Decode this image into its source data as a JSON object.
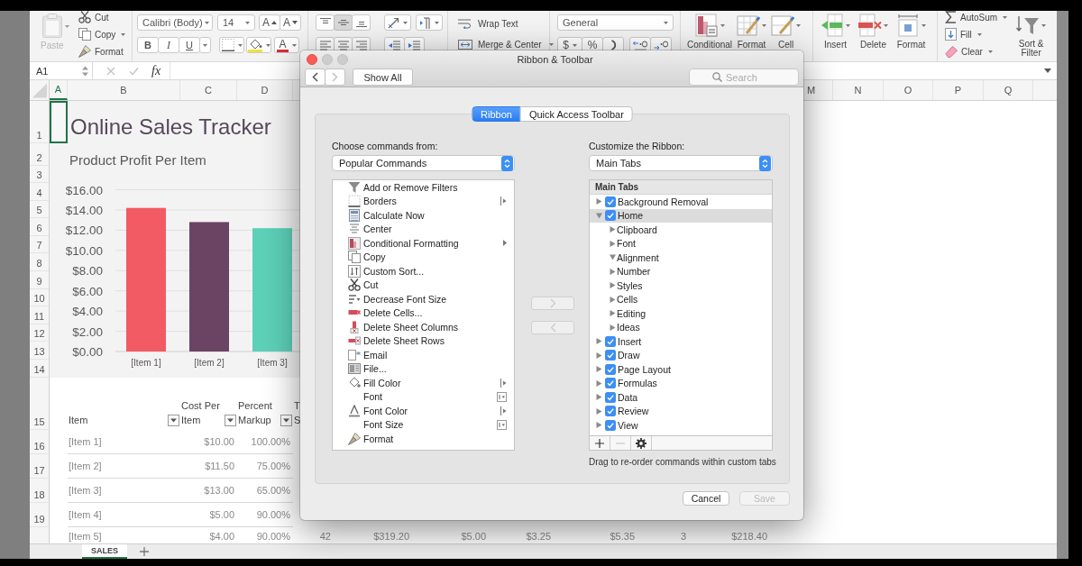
{
  "ribbon": {
    "paste": {
      "label": "Paste",
      "disabled": true
    },
    "clipboard": [
      "Cut",
      "Copy",
      "Format"
    ],
    "font": {
      "name": "Calibri (Body)",
      "size": "14",
      "grow": "A",
      "shrink": "A",
      "bold": "B",
      "italic": "I",
      "underline": "U",
      "paint_button": "A"
    },
    "vertical_align": [
      {
        "selected": false
      },
      {
        "selected": true
      },
      {
        "selected": false
      }
    ],
    "wrap_text": "Wrap Text",
    "merge": "Merge & Center",
    "number": {
      "format": "General",
      "currency": "$",
      "percent": "%"
    },
    "styles": [
      "Conditional",
      "Format",
      "Cell"
    ],
    "cells": [
      "Insert",
      "Delete",
      "Format"
    ],
    "editing": [
      "AutoSum",
      "Fill",
      "Clear"
    ],
    "sort_filter": "Sort &\nFilter"
  },
  "formula_bar": {
    "name_box": "A1",
    "function_label": "fx"
  },
  "sheet": {
    "columns": [
      {
        "label": "A",
        "selected": true
      },
      {
        "label": "B",
        "selected": false
      },
      {
        "label": "C",
        "selected": false
      },
      {
        "label": "D",
        "selected": false
      },
      {
        "label": "M",
        "selected": false
      },
      {
        "label": "N",
        "selected": false
      },
      {
        "label": "O",
        "selected": false
      },
      {
        "label": "P",
        "selected": false
      },
      {
        "label": "Q",
        "selected": false
      }
    ],
    "rows": [
      "1",
      "2",
      "3",
      "4",
      "5",
      "6",
      "7",
      "8",
      "9",
      "10",
      "11",
      "12",
      "13",
      "14",
      "15",
      "16",
      "17",
      "18",
      "19"
    ],
    "title": "Online Sales Tracker",
    "chart": {
      "chart_data": {
        "type": "bar",
        "title": "Product Profit Per Item",
        "categories": [
          "[Item 1]",
          "[Item 2]",
          "[Item 3]"
        ],
        "values": [
          14.2,
          12.8,
          12.2
        ],
        "colors": [
          "#f25a64",
          "#6a4462",
          "#5dd1b8"
        ],
        "ylim": [
          0,
          16
        ],
        "grid": true,
        "yticks": [
          {
            "value": 0,
            "label": "$0.00"
          },
          {
            "value": 2,
            "label": "$2.00"
          },
          {
            "value": 4,
            "label": "$4.00"
          },
          {
            "value": 6,
            "label": "$6.00"
          },
          {
            "value": 8,
            "label": "$8.00"
          },
          {
            "value": 10,
            "label": "$10.00"
          },
          {
            "value": 12,
            "label": "$12.00"
          },
          {
            "value": 14,
            "label": "$14.00"
          },
          {
            "value": 16,
            "label": "$16.00"
          }
        ]
      }
    },
    "table": {
      "columns": [
        {
          "label": "Item",
          "filter": true
        },
        {
          "label": "Cost Per\nItem",
          "filter": true
        },
        {
          "label": "Percent\nMarkup",
          "filter": true
        },
        {
          "label": "T\nS",
          "filter": false
        }
      ],
      "rows": [
        {
          "cells": [
            "[Item 1]",
            "$10.00",
            "100.00%"
          ]
        },
        {
          "cells": [
            "[Item 2]",
            "$11.50",
            "75.00%"
          ]
        },
        {
          "cells": [
            "[Item 3]",
            "$13.00",
            "65.00%"
          ]
        },
        {
          "cells": [
            "[Item 4]",
            "$5.00",
            "90.00%"
          ]
        },
        {
          "cells": [
            "[Item 5]",
            "$4.00",
            "90.00%",
            "42",
            "$319.20",
            "$5.00",
            "$3.25",
            "$5.35",
            "3",
            "$218.40"
          ]
        }
      ]
    },
    "sheet_tabs": [
      {
        "label": "SALES",
        "selected": true
      }
    ]
  },
  "dialog": {
    "title": "Ribbon & Toolbar",
    "window_buttons": [
      {
        "kind": "close",
        "disabled": false
      },
      {
        "kind": "minimize",
        "disabled": true
      },
      {
        "kind": "zoom",
        "disabled": true
      }
    ],
    "nav_buttons": [
      {
        "kind": "back",
        "disabled": false
      },
      {
        "kind": "forward",
        "disabled": true
      }
    ],
    "show_all": "Show All",
    "search": {
      "placeholder": "Search"
    },
    "tabs": [
      {
        "label": "Ribbon",
        "selected": true
      },
      {
        "label": "Quick Access Toolbar",
        "selected": false
      }
    ],
    "commands": {
      "label": "Choose commands from:",
      "source": "Popular Commands",
      "items": [
        {
          "label": "Add or Remove Filters",
          "kind": "button",
          "selected": false
        },
        {
          "label": "Borders",
          "kind": "split",
          "selected": false
        },
        {
          "label": "Calculate Now",
          "kind": "button",
          "selected": false
        },
        {
          "label": "Center",
          "kind": "button",
          "selected": false
        },
        {
          "label": "Conditional Formatting",
          "kind": "menu",
          "selected": false
        },
        {
          "label": "Copy",
          "kind": "button",
          "selected": false
        },
        {
          "label": "Custom Sort...",
          "kind": "button",
          "selected": false
        },
        {
          "label": "Cut",
          "kind": "button",
          "selected": false
        },
        {
          "label": "Decrease Font Size",
          "kind": "button",
          "selected": false
        },
        {
          "label": "Delete Cells...",
          "kind": "button",
          "selected": false
        },
        {
          "label": "Delete Sheet Columns",
          "kind": "button",
          "selected": false
        },
        {
          "label": "Delete Sheet Rows",
          "kind": "button",
          "selected": false
        },
        {
          "label": "Email",
          "kind": "button",
          "selected": false
        },
        {
          "label": "File...",
          "kind": "button",
          "selected": false
        },
        {
          "label": "Fill Color",
          "kind": "split",
          "selected": false
        },
        {
          "label": "Font",
          "kind": "combo",
          "selected": false
        },
        {
          "label": "Font Color",
          "kind": "split",
          "selected": false
        },
        {
          "label": "Font Size",
          "kind": "combo",
          "selected": false
        },
        {
          "label": "Format",
          "kind": "button",
          "selected": false
        }
      ]
    },
    "move_buttons": [
      {
        "kind": "add",
        "disabled": true
      },
      {
        "kind": "remove",
        "disabled": true
      }
    ],
    "customize": {
      "label": "Customize the Ribbon:",
      "source": "Main Tabs",
      "header": "Main Tabs",
      "items": [
        {
          "label": "Background Removal",
          "checked": true,
          "expanded": false,
          "selected": false
        },
        {
          "label": "Home",
          "checked": true,
          "expanded": true,
          "selected": true,
          "children": [
            {
              "label": "Clipboard",
              "expanded": false,
              "selected": false
            },
            {
              "label": "Font",
              "expanded": false,
              "selected": false
            },
            {
              "label": "Alignment",
              "expanded": true,
              "selected": false
            },
            {
              "label": "Number",
              "expanded": false,
              "selected": false
            },
            {
              "label": "Styles",
              "expanded": false,
              "selected": false
            },
            {
              "label": "Cells",
              "expanded": false,
              "selected": false
            },
            {
              "label": "Editing",
              "expanded": false,
              "selected": false
            },
            {
              "label": "Ideas",
              "expanded": false,
              "selected": false
            }
          ]
        },
        {
          "label": "Insert",
          "checked": true,
          "expanded": false,
          "selected": false
        },
        {
          "label": "Draw",
          "checked": true,
          "expanded": false,
          "selected": false
        },
        {
          "label": "Page Layout",
          "checked": true,
          "expanded": false,
          "selected": false
        },
        {
          "label": "Formulas",
          "checked": true,
          "expanded": false,
          "selected": false
        },
        {
          "label": "Data",
          "checked": true,
          "expanded": false,
          "selected": false
        },
        {
          "label": "Review",
          "checked": true,
          "expanded": false,
          "selected": false
        },
        {
          "label": "View",
          "checked": true,
          "expanded": false,
          "selected": false
        }
      ],
      "tools": [
        {
          "kind": "add",
          "disabled": false
        },
        {
          "kind": "remove",
          "disabled": true
        },
        {
          "kind": "settings",
          "disabled": false
        }
      ]
    },
    "hint": "Drag to re-order commands within custom tabs",
    "buttons": [
      {
        "label": "Cancel",
        "disabled": false
      },
      {
        "label": "Save",
        "disabled": true
      }
    ]
  }
}
